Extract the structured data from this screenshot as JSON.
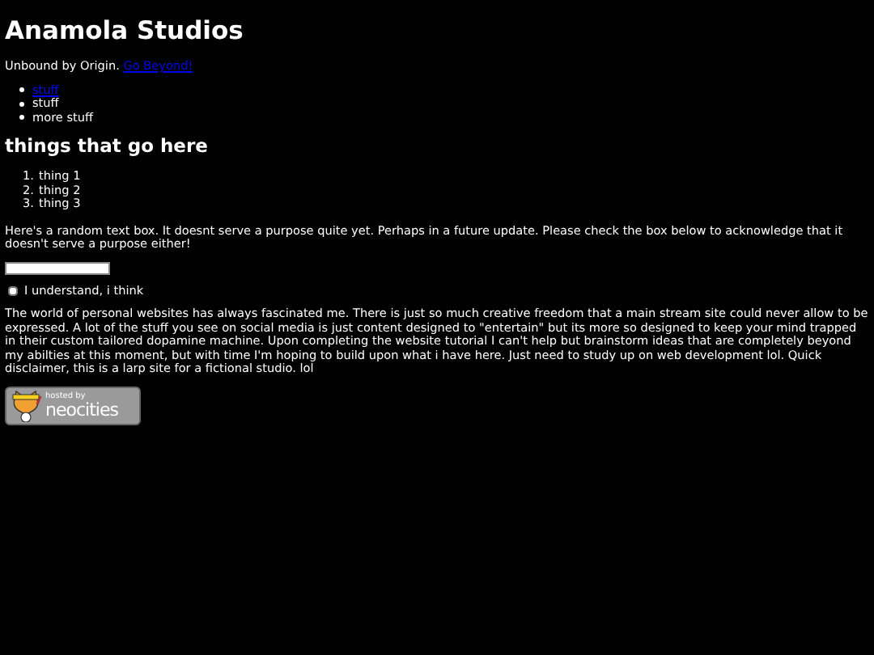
{
  "title": "Anamola Studios",
  "tagline": {
    "text": "Unbound by Origin.",
    "link": "Go Beyond!"
  },
  "bullets": [
    {
      "label": "stuff",
      "link": true
    },
    {
      "label": "stuff",
      "link": false
    },
    {
      "label": "more stuff",
      "link": false
    }
  ],
  "heading": "things that go here",
  "numbered": [
    {
      "number": "1.",
      "label": "thing 1"
    },
    {
      "number": "2.",
      "label": "thing 2"
    },
    {
      "number": "3.",
      "label": "thing 3"
    }
  ],
  "intro": "Here's a random text box. It doesnt serve a purpose quite yet. Perhaps in a future update. Please check the box below to acknowledge that it doesn't serve a purpose either!",
  "checkbox": {
    "label": "I understand, i think",
    "checked": false
  },
  "paragraph": "The world of personal websites has always fascinated me. There is just so much creative freedom that a main stream site could never allow to be expressed. A lot of the stuff you see on social media is just content designed to \"entertain\" but its more so designed to keep your mind trapped in their custom tailored dopamine machine. Upon completing the website tutorial I can't help but brainstorm ideas that are completely beyond my abilties at this moment, but with time I'm hoping to build upon what i have here. Just need to study up on web development lol. Quick disclaimer, this is a larp site for a fictional studio. lol",
  "badge": {
    "small": "hosted by",
    "big": "neocities"
  }
}
